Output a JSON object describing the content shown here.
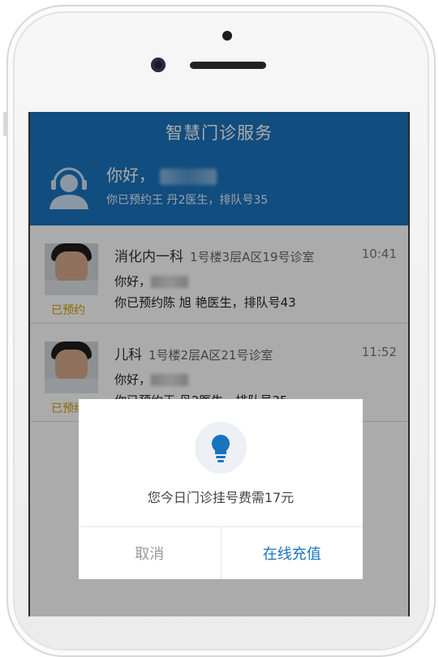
{
  "header": {
    "title": "智慧门诊服务",
    "greeting": "你好，",
    "status": "你已预约王 丹2医生，排队号35"
  },
  "appointments": [
    {
      "dept": "消化内一科",
      "location": "1号楼3层A区19号诊室",
      "time": "10:41",
      "hello": "你好，",
      "detail": "你已预约陈 旭 艳医生，排队号43",
      "badge": "已预约"
    },
    {
      "dept": "儿科",
      "location": "1号楼2层A区21号诊室",
      "time": "11:52",
      "hello": "你好，",
      "detail": "你已预约王 丹2医生，排队号35",
      "badge": "已预约"
    }
  ],
  "dialog": {
    "icon": "lightbulb-icon",
    "message": "您今日门诊挂号费需17元",
    "cancel_label": "取消",
    "confirm_label": "在线充值"
  },
  "colors": {
    "primary": "#1a73be",
    "badge": "#c9a200"
  }
}
